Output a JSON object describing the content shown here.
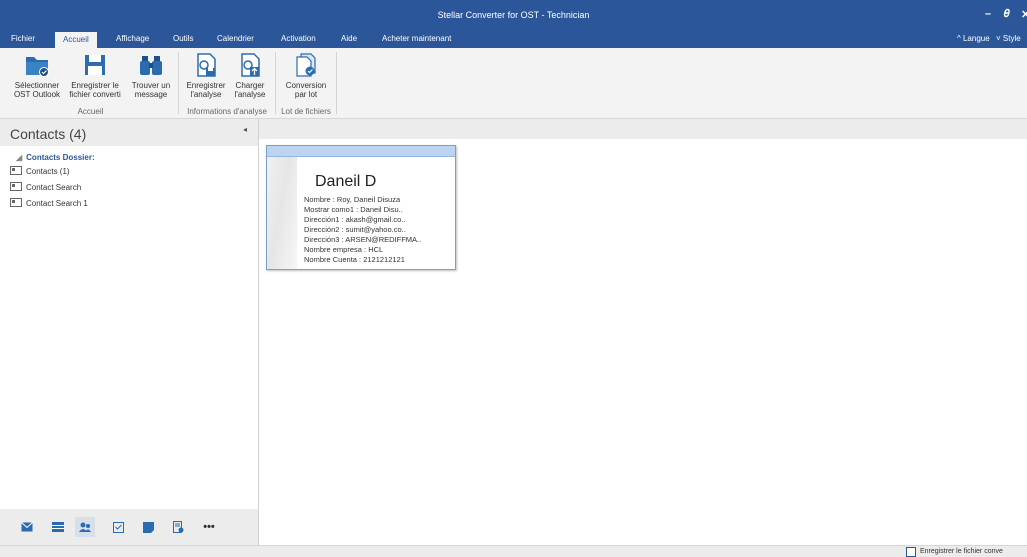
{
  "app": {
    "title": "Stellar Converter for OST - Technician"
  },
  "window_controls": {
    "minimize": "–",
    "restore": "🗗",
    "close": "✕"
  },
  "menu": {
    "tabs": [
      "Fichier",
      "Accueil",
      "Affichage",
      "Outils",
      "Calendrier",
      "Activation",
      "Aide",
      "Acheter maintenant"
    ],
    "active_tab": "Accueil",
    "language_label": "^ Langue",
    "style_label": "˅ Style"
  },
  "ribbon": {
    "buttons": [
      {
        "line1": "Sélectionner",
        "line2": "OST Outlook",
        "icon": "folder-open-icon"
      },
      {
        "line1": "Enregistrer le",
        "line2": "fichier converti",
        "icon": "save-icon"
      },
      {
        "line1": "Trouver un",
        "line2": "message",
        "icon": "binoculars-icon"
      },
      {
        "line1": "Enregistrer",
        "line2": "l'analyse",
        "icon": "save-scan-icon"
      },
      {
        "line1": "Charger",
        "line2": "l'analyse",
        "icon": "load-scan-icon"
      },
      {
        "line1": "Conversion",
        "line2": "par lot",
        "icon": "batch-convert-icon"
      }
    ],
    "groups": [
      "Accueil",
      "Informations d'analyse",
      "Lot de fichiers"
    ]
  },
  "left_pane": {
    "title": "Contacts (4)",
    "collapse_glyph": "◂",
    "folder_label": "Contacts Dossier:",
    "items": [
      "Contacts (1)",
      "Contact Search",
      "Contact Search 1"
    ]
  },
  "nav_icons": [
    "mail-icon",
    "calendar-icon",
    "contacts-icon",
    "tasks-icon",
    "notes-icon",
    "journal-icon",
    "more-icon"
  ],
  "nav_more": "•••",
  "contact_card": {
    "name": "Daneil D",
    "fields": [
      "Nombre : Roy, Daneil Disuza",
      "Mostrar como1 : Daneil Disu..",
      "Dirección1 : akash@gmail.co..",
      "Dirección2 : sumit@yahoo.co..",
      "Dirección3 : ARSEN@REDIFFMA..",
      "Nombre empresa : HCL",
      "Nombre Cuenta : 2121212121"
    ]
  },
  "status": {
    "checkbox_label": "Enregistrer le fichier conve"
  },
  "colors": {
    "accent": "#2b579a",
    "ribbon_bg": "#f3f3f3",
    "card_header": "#bcd4f2"
  }
}
